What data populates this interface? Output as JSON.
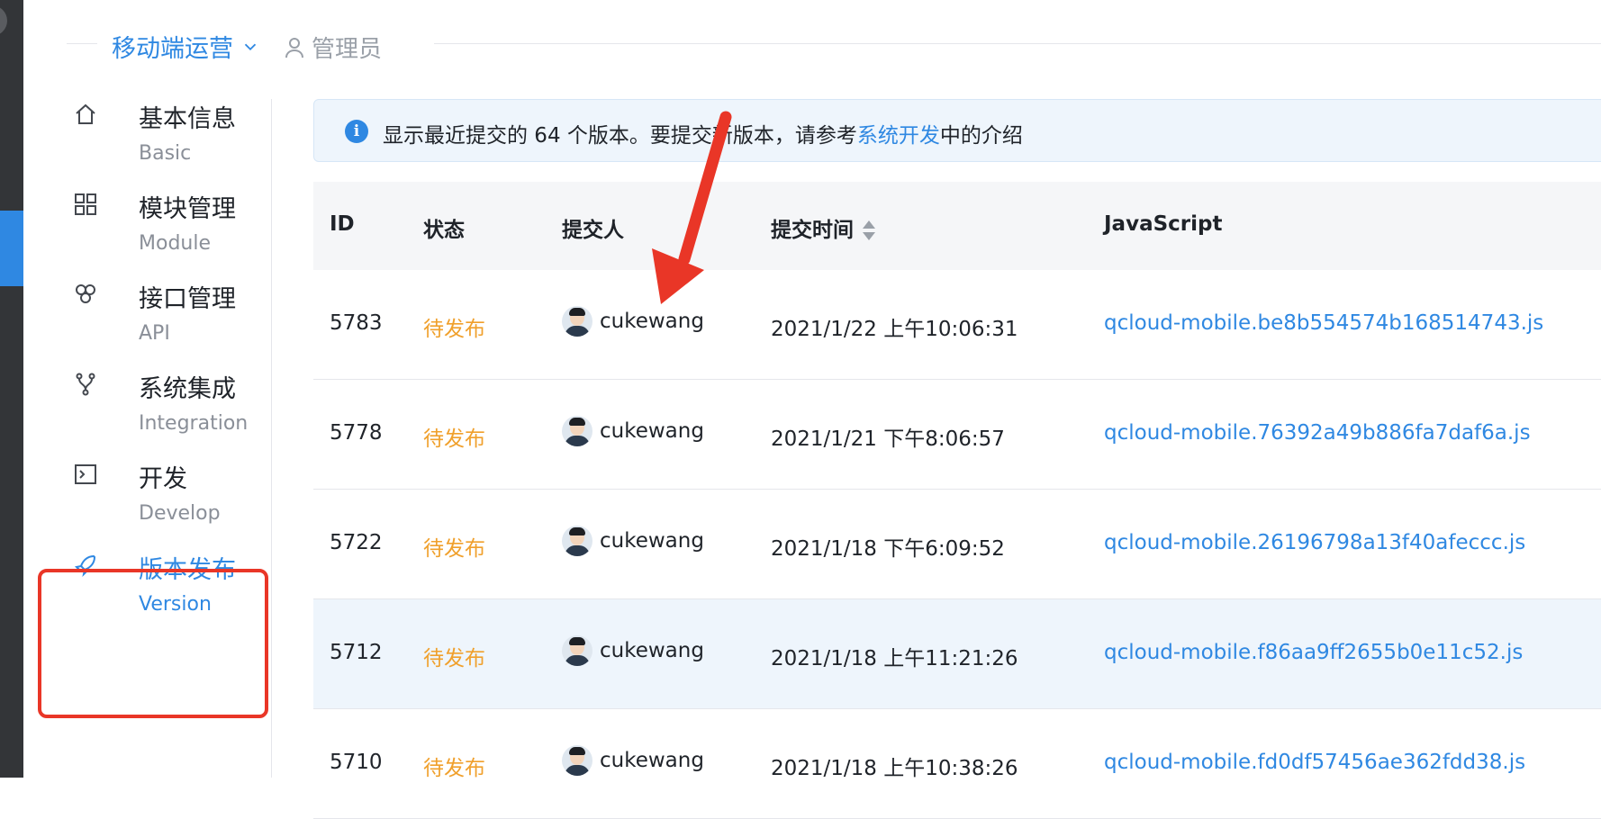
{
  "header": {
    "project": "移动端运营",
    "role": "管理员"
  },
  "sidebar": {
    "items": [
      {
        "zh": "基本信息",
        "en": "Basic",
        "icon": "home-icon"
      },
      {
        "zh": "模块管理",
        "en": "Module",
        "icon": "grid-icon"
      },
      {
        "zh": "接口管理",
        "en": "API",
        "icon": "api-icon"
      },
      {
        "zh": "系统集成",
        "en": "Integration",
        "icon": "integration-icon"
      },
      {
        "zh": "开发",
        "en": "Develop",
        "icon": "terminal-icon"
      },
      {
        "zh": "版本发布",
        "en": "Version",
        "icon": "rocket-icon",
        "active": true
      }
    ]
  },
  "notice": {
    "text_before": "显示最近提交的 64 个版本。要提交新版本，请参考",
    "link": "系统开发",
    "text_after": "中的介绍"
  },
  "table": {
    "headers": [
      "ID",
      "状态",
      "提交人",
      "提交时间",
      "JavaScript"
    ],
    "rows": [
      {
        "id": "5783",
        "status": "待发布",
        "user": "cukewang",
        "time": "2021/1/22 上午10:06:31",
        "js": "qcloud-mobile.be8b554574b168514743.js"
      },
      {
        "id": "5778",
        "status": "待发布",
        "user": "cukewang",
        "time": "2021/1/21 下午8:06:57",
        "js": "qcloud-mobile.76392a49b886fa7daf6a.js"
      },
      {
        "id": "5722",
        "status": "待发布",
        "user": "cukewang",
        "time": "2021/1/18 下午6:09:52",
        "js": "qcloud-mobile.26196798a13f40afeccc.js"
      },
      {
        "id": "5712",
        "status": "待发布",
        "user": "cukewang",
        "time": "2021/1/18 上午11:21:26",
        "js": "qcloud-mobile.f86aa9ff2655b0e11c52.js"
      },
      {
        "id": "5710",
        "status": "待发布",
        "user": "cukewang",
        "time": "2021/1/18 上午10:38:26",
        "js": "qcloud-mobile.fd0df57456ae362fdd38.js"
      }
    ]
  },
  "colors": {
    "accent": "#2f88e2",
    "status_pending": "#f0a02c",
    "annotation_red": "#e93627"
  }
}
